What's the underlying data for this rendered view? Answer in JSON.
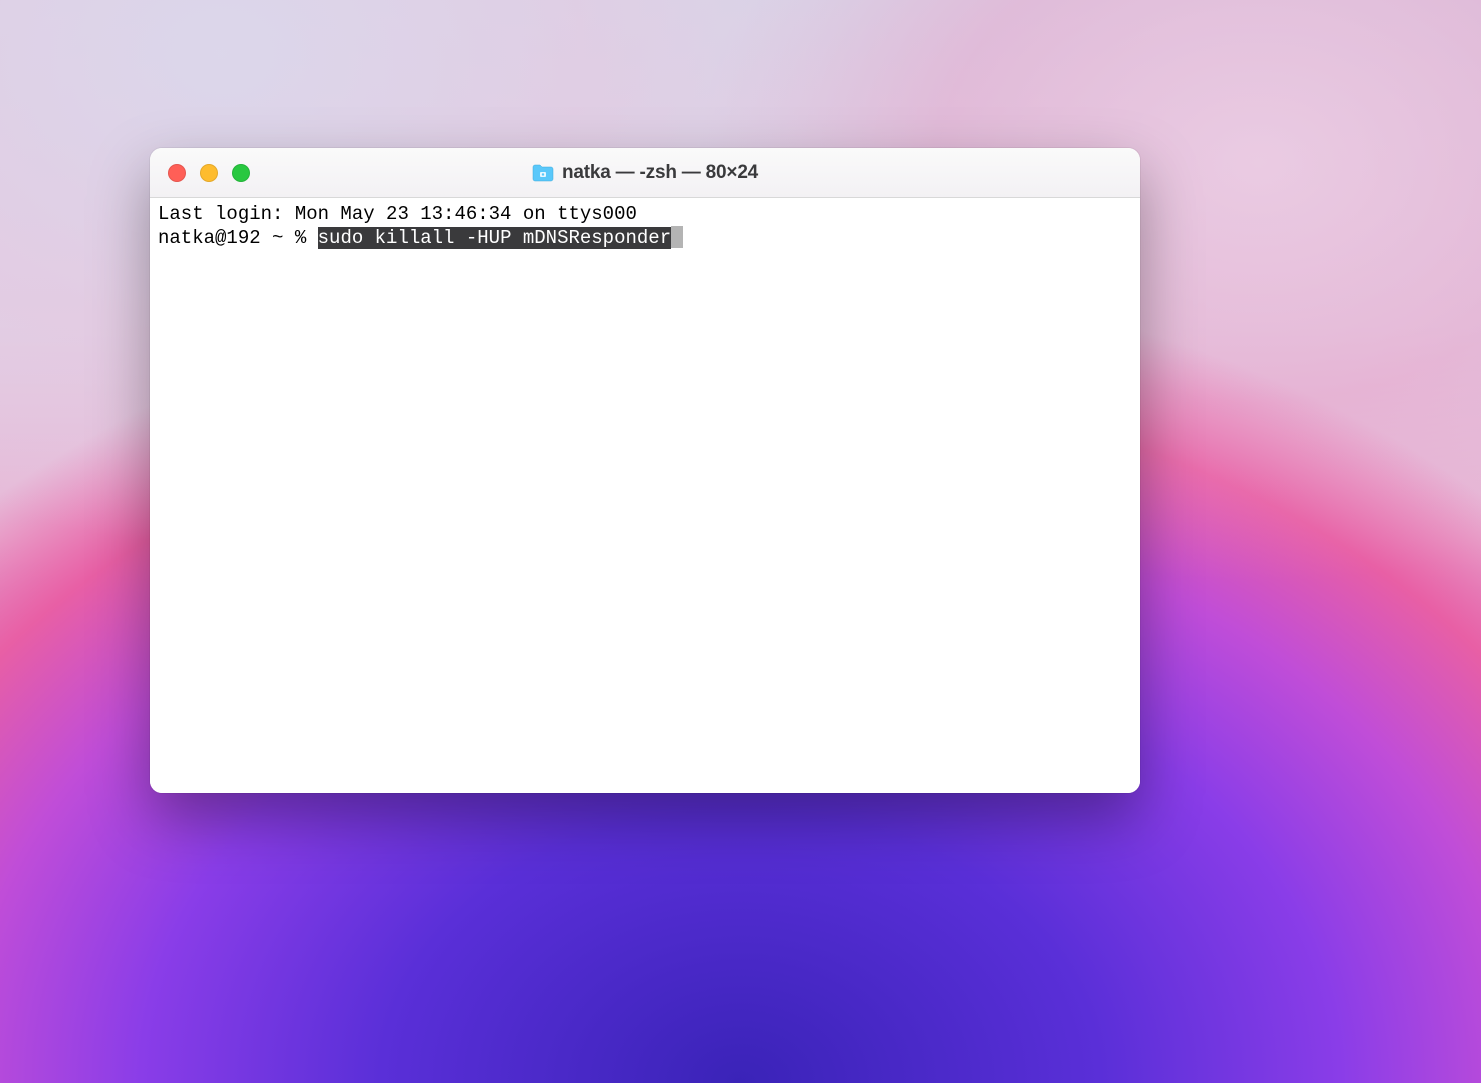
{
  "window": {
    "title": "natka — -zsh — 80×24"
  },
  "terminal": {
    "last_login": "Last login: Mon May 23 13:46:34 on ttys000",
    "prompt": "natka@192 ~ % ",
    "command": "sudo killall -HUP mDNSResponder"
  },
  "colors": {
    "close": "#ff5f57",
    "minimize": "#febc2e",
    "maximize": "#28c840",
    "selection_bg": "#3a3a3c",
    "selection_fg": "#ffffff"
  }
}
